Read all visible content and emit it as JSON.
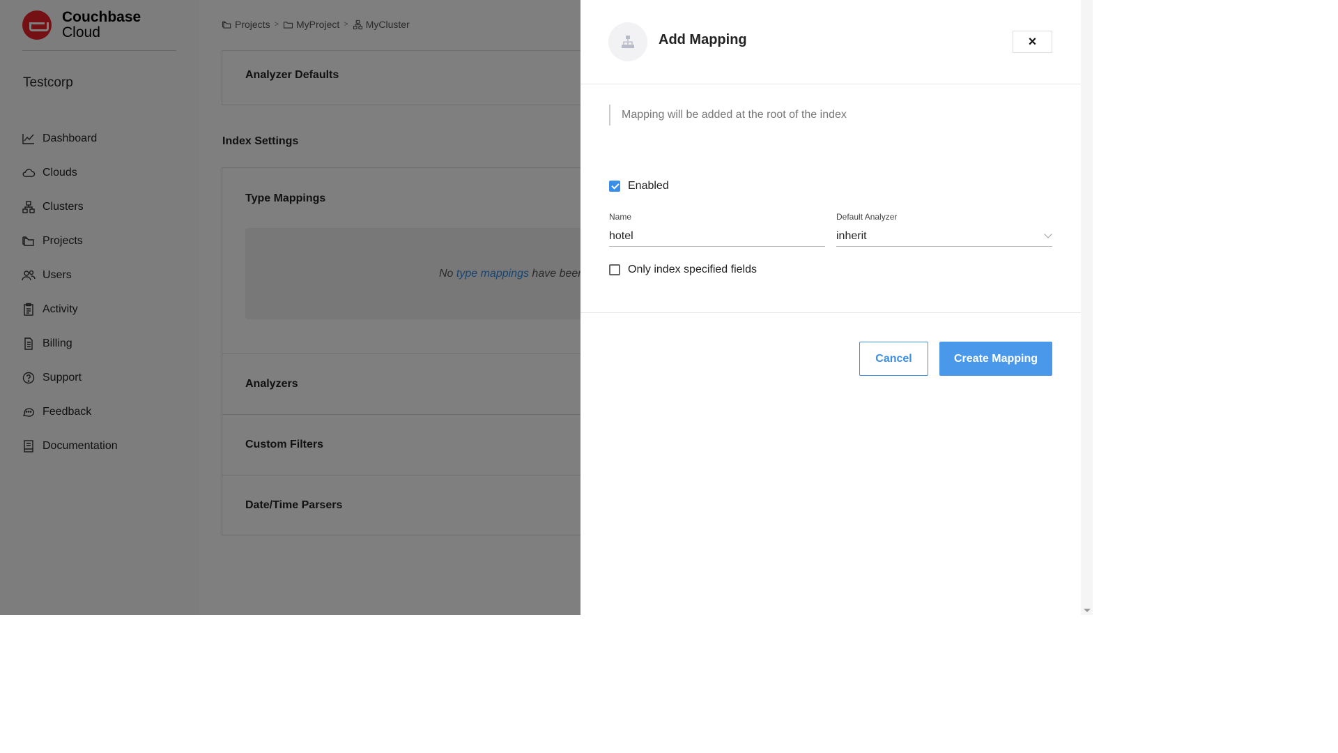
{
  "brand": {
    "line1": "Couchbase",
    "line2": "Cloud"
  },
  "sidebar": {
    "org": "Testcorp",
    "items": [
      {
        "label": "Dashboard",
        "icon": "chart-icon"
      },
      {
        "label": "Clouds",
        "icon": "cloud-icon"
      },
      {
        "label": "Clusters",
        "icon": "cluster-icon"
      },
      {
        "label": "Projects",
        "icon": "folders-icon"
      },
      {
        "label": "Users",
        "icon": "users-icon"
      },
      {
        "label": "Activity",
        "icon": "clipboard-icon"
      },
      {
        "label": "Billing",
        "icon": "document-icon"
      },
      {
        "label": "Support",
        "icon": "help-icon"
      },
      {
        "label": "Feedback",
        "icon": "chat-icon"
      },
      {
        "label": "Documentation",
        "icon": "book-icon"
      }
    ]
  },
  "breadcrumb": {
    "items": [
      {
        "label": "Projects",
        "icon": "folders-icon"
      },
      {
        "label": "MyProject",
        "icon": "folder-icon"
      },
      {
        "label": "MyCluster",
        "icon": "cluster-icon"
      }
    ]
  },
  "main": {
    "analyzer_defaults": "Analyzer Defaults",
    "index_settings": "Index Settings",
    "type_mappings": "Type Mappings",
    "empty_prefix": "No",
    "empty_link": "type mappings",
    "empty_suffix": "have been c",
    "analyzers": "Analyzers",
    "custom_filters": "Custom Filters",
    "date_time_parsers": "Date/Time Parsers"
  },
  "drawer": {
    "title": "Add Mapping",
    "close_label": "×",
    "info": "Mapping will be added at the root of the index",
    "enabled_label": "Enabled",
    "enabled_checked": true,
    "name_label": "Name",
    "name_value": "hotel",
    "analyzer_label": "Default Analyzer",
    "analyzer_value": "inherit",
    "only_index_label": "Only index specified fields",
    "only_index_checked": false,
    "cancel_label": "Cancel",
    "create_label": "Create Mapping"
  },
  "colors": {
    "accent": "#3b8ee8",
    "brand": "#ea2328"
  }
}
